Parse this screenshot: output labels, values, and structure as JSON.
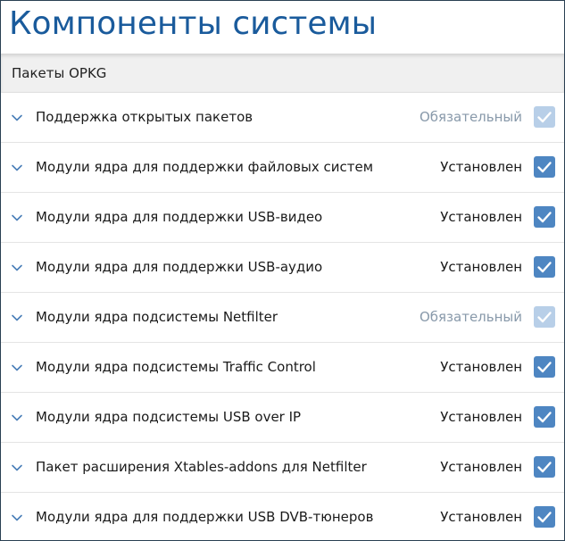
{
  "page": {
    "title": "Компоненты системы"
  },
  "section": {
    "title": "Пакеты OPKG"
  },
  "colors": {
    "title": "#1a5b9c",
    "checkbox_checked": "#4e86c2",
    "checkbox_disabled": "#b8cfe8",
    "status_muted": "#8899aa"
  },
  "packages": [
    {
      "label": "Поддержка открытых пакетов",
      "status": "Обязательный",
      "required": true,
      "checked": true
    },
    {
      "label": "Модули ядра для поддержки файловых систем",
      "status": "Установлен",
      "required": false,
      "checked": true
    },
    {
      "label": "Модули ядра для поддержки USB-видео",
      "status": "Установлен",
      "required": false,
      "checked": true
    },
    {
      "label": "Модули ядра для поддержки USB-аудио",
      "status": "Установлен",
      "required": false,
      "checked": true
    },
    {
      "label": "Модули ядра подсистемы Netfilter",
      "status": "Обязательный",
      "required": true,
      "checked": true
    },
    {
      "label": "Модули ядра подсистемы Traffic Control",
      "status": "Установлен",
      "required": false,
      "checked": true
    },
    {
      "label": "Модули ядра подсистемы USB over IP",
      "status": "Установлен",
      "required": false,
      "checked": true
    },
    {
      "label": "Пакет расширения Xtables-addons для Netfilter",
      "status": "Установлен",
      "required": false,
      "checked": true
    },
    {
      "label": "Модули ядра для поддержки USB DVB-тюнеров",
      "status": "Установлен",
      "required": false,
      "checked": true
    }
  ]
}
